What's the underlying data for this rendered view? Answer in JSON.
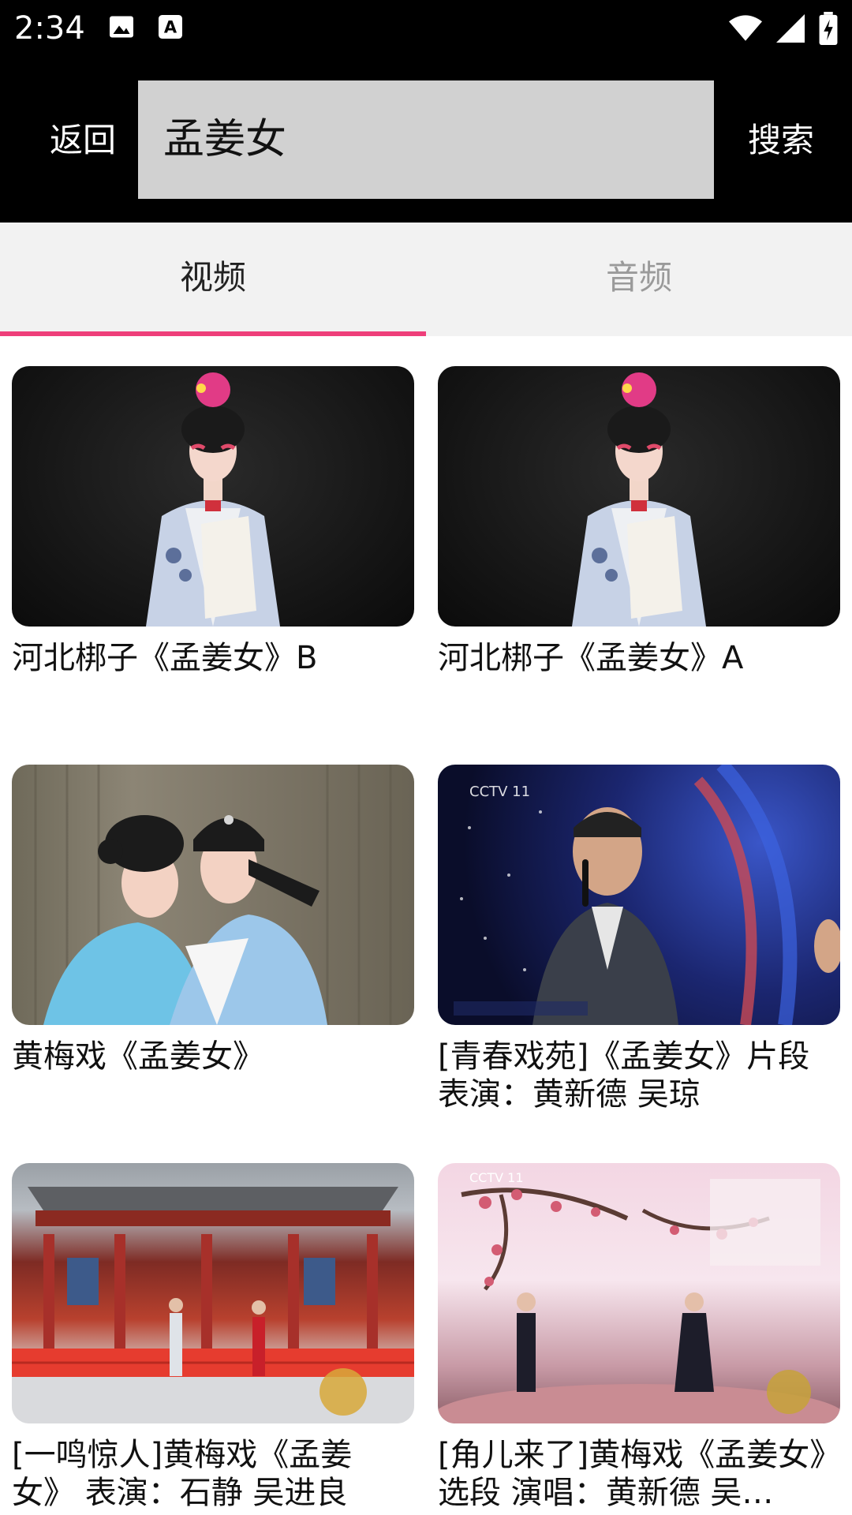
{
  "status_bar": {
    "time": "2:34",
    "icons": [
      "image-icon",
      "a-icon",
      "wifi-icon",
      "signal-icon",
      "battery-icon"
    ]
  },
  "header": {
    "back_label": "返回",
    "search_value": "孟姜女",
    "search_label": "搜索"
  },
  "tabs": [
    {
      "label": "视频",
      "active": true
    },
    {
      "label": "音频",
      "active": false
    }
  ],
  "colors": {
    "accent": "#ee3f7a",
    "header_bg": "#000000",
    "search_bg": "#d1d1d1",
    "tab_bg": "#f2f2f2"
  },
  "results": [
    {
      "title": "河北梆子《孟姜女》B",
      "thumbnail": "opera-performer-dark"
    },
    {
      "title": "河北梆子《孟姜女》A",
      "thumbnail": "opera-performer-dark"
    },
    {
      "title": "黄梅戏《孟姜女》",
      "thumbnail": "opera-couple-stage"
    },
    {
      "title": "[青春戏苑]《孟姜女》片段 表演：黄新德 吴琼",
      "thumbnail": "tv-singer-stage"
    },
    {
      "title": "[一鸣惊人]黄梅戏《孟姜女》 表演：石静 吴进良",
      "thumbnail": "courtyard-stage"
    },
    {
      "title": "[角儿来了]黄梅戏《孟姜女》选段 演唱：黄新德 吴…",
      "thumbnail": "pink-blossom-stage"
    }
  ]
}
